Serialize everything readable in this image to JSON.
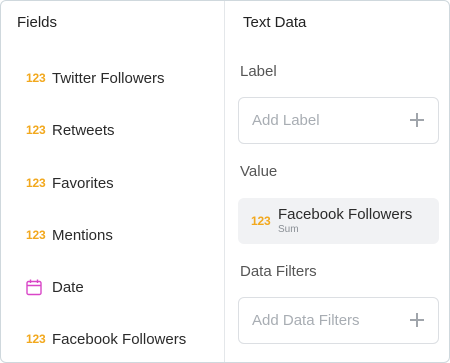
{
  "fields_panel": {
    "title": "Fields",
    "items": [
      {
        "type_label": "123",
        "label": "Twitter Followers"
      },
      {
        "type_label": "123",
        "label": "Retweets"
      },
      {
        "type_label": "123",
        "label": "Favorites"
      },
      {
        "type_label": "123",
        "label": "Mentions"
      },
      {
        "type_icon": "calendar-icon",
        "label": "Date"
      },
      {
        "type_label": "123",
        "label": "Facebook Followers"
      }
    ]
  },
  "text_data_panel": {
    "title": "Text Data",
    "label_section": {
      "heading": "Label",
      "placeholder": "Add Label",
      "icon": "plus-icon"
    },
    "value_section": {
      "heading": "Value",
      "type_label": "123",
      "field_name": "Facebook Followers",
      "aggregation": "Sum"
    },
    "filters_section": {
      "heading": "Data Filters",
      "placeholder": "Add Data Filters",
      "icon": "plus-icon"
    }
  },
  "colors": {
    "numeric_icon": "#f2a81d",
    "date_icon": "#d946c7",
    "pill_background": "#f1f2f4",
    "border": "#dcdfe3"
  }
}
